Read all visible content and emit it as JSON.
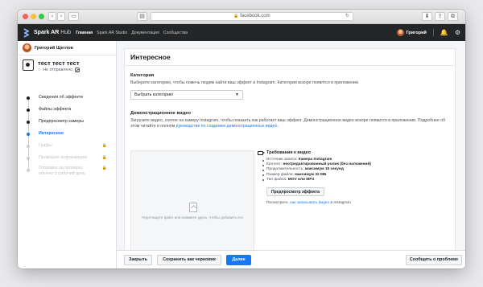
{
  "browser": {
    "url": "facebook.com",
    "lock_icon": "🔒",
    "reload_icon": "↻",
    "back_icon": "‹",
    "forward_icon": "›",
    "sidebar_icon": "▭",
    "share_icon": "⇪",
    "tabs_icon": "⧉",
    "download_icon": "⬇",
    "reader_icon": "▤"
  },
  "topbar": {
    "brand_bold": "Spark AR",
    "brand_light": " Hub",
    "nav": [
      "Главная",
      "Spark AR Studio",
      "Документация",
      "Сообщества"
    ],
    "user": "Григорий",
    "bell_icon": "🔔",
    "gear_icon": "⚙"
  },
  "sidebar": {
    "user_name": "Григорий Щеглов",
    "effect_name": "тест тест тест",
    "effect_status": "Не отправлено",
    "steps": [
      {
        "label": "Сведения об эффекте",
        "state": "done"
      },
      {
        "label": "Файлы эффекта",
        "state": "done"
      },
      {
        "label": "Предпросмотр камеры",
        "state": "done"
      },
      {
        "label": "Интересное",
        "state": "active"
      },
      {
        "label": "Графы",
        "state": "locked"
      },
      {
        "label": "Проверьте информацию",
        "state": "locked"
      },
      {
        "label": "Отправка на проверку обычно 1 рабочий день",
        "state": "locked"
      }
    ],
    "lock_icon": "🔒"
  },
  "panel": {
    "title": "Интересное",
    "category": {
      "heading": "Категория",
      "description": "Выберите категорию, чтобы помочь людям найти ваш эффект в Instagram. Категории вскоре появятся в приложении.",
      "select_value": "Выбрать категорию",
      "caret": "▼"
    },
    "demo": {
      "heading": "Демонстрационное видео",
      "description_part1": "Загрузите видео, снятое на камеру Instagram, чтобы показать как работает ваш эффект. Демонстрационное видео вскоре появится в приложении. Подробнее об этом читайте в полном ",
      "description_link": "руководстве по созданию демонстрационных видео",
      "description_part2": ".",
      "drop_text": "Перетащите файл или нажмите здесь, чтобы добавить его"
    },
    "requirements": {
      "heading": "Требования к видео",
      "items": [
        {
          "label": "Источник записи: ",
          "value": "Камера Instagram"
        },
        {
          "label": "Контент: ",
          "value": "неотредактированный ролик (без наложений)"
        },
        {
          "label": "Продолжительность: ",
          "value": "максимум 15 секунд"
        },
        {
          "label": "Размер файла: ",
          "value": "максимум 32 МБ"
        },
        {
          "label": "Тип файла: ",
          "value": "MOV или MP4"
        }
      ],
      "preview_button": "Предпросмотр эффекта",
      "note_prefix": "Посмотрите, ",
      "note_link": "как записывать видео",
      "note_suffix": " в Instagram"
    }
  },
  "footer": {
    "close": "Закрыть",
    "save_draft": "Сохранить как черновик",
    "next": "Далее",
    "report": "Сообщить о проблеме"
  }
}
